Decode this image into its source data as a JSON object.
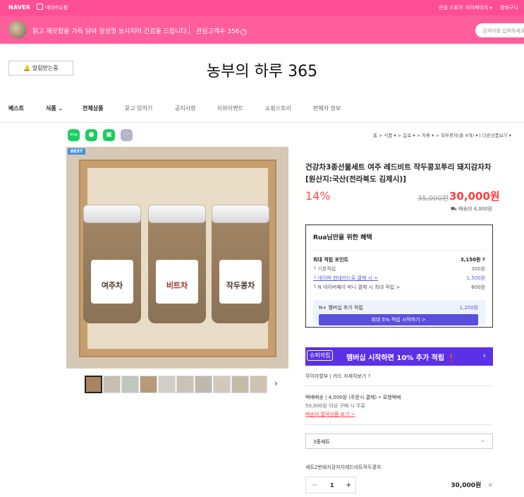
{
  "topbar": {
    "logo": "NAVER",
    "shop": "네이버쇼핑",
    "links": [
      "관심 스토어",
      "마이페이지 ▾",
      "장바구니"
    ]
  },
  "banner": {
    "desc": "맑고 깨끗함을 가득 담아 정성껏 농사지어 건강을 드립니다.",
    "fans_label": "관심고객수 356",
    "q": "?",
    "search_placeholder": "검색어를 입력하세요"
  },
  "notify": "🔔 알림받는중",
  "store_name": "농부의 하루 365",
  "nav": [
    "베스트",
    "식품 ⌄",
    "전체상품",
    "묻고 답하기",
    "공지사항",
    "리뷰이벤트",
    "쇼핑스토리",
    "판매자 정보"
  ],
  "share": [
    {
      "name": "blog",
      "color": "#19ce60",
      "glyph": "blog"
    },
    {
      "name": "talk",
      "color": "#19ce60",
      "glyph": "●"
    },
    {
      "name": "band",
      "color": "#19ce60",
      "glyph": "▣"
    },
    {
      "name": "more",
      "color": "#b0b6c8",
      "glyph": "···"
    }
  ],
  "breadcrumb": "홈 > 식품 ▾ > 음료 ▾ > 차류 ▾ > 작두콩차(총 4개) ▾ | 다른상품보기 ▾",
  "photo": {
    "badge": "BEST",
    "jars": [
      "여주차",
      "비트차",
      "작두콩차"
    ]
  },
  "thumb_next": "›",
  "product": {
    "title": "건강차3종선물세트 여주 레드비트 작두콩꼬투리 돼지감자차 [원산지:국산(전라북도 김제시)]",
    "discount": "14%",
    "original": "35,000원",
    "price": "30,000원",
    "shipping": "배송비 4,000원"
  },
  "benefit": {
    "title": "Rua님만을 위한 혜택",
    "rows": [
      {
        "label": "최대 적립 포인트",
        "value": "3,150원 ?"
      },
      {
        "label": "└ 기본적립",
        "value": "300원"
      },
      {
        "label": "└ 네이버 현대카드로 결제 시 >",
        "value": "1,500원"
      },
      {
        "label": "└ N 네이버페이 머니 결제 시 최대 적립 >",
        "value": "600원"
      }
    ],
    "member_label": "N+ 멤버십 추가 적립",
    "member_value": "1,200원",
    "member_btn": "최대 5% 적립 시작하기 >"
  },
  "ad": {
    "tag": "슈퍼적립",
    "text": "멤버십 시작하면 10% 추가 적립 ❗",
    "arrow": "›"
  },
  "installment": "무이자할부 | 카드 자세히보기 ?",
  "shipping_info": {
    "line1": "택배배송 | 4,000원 (주문시 결제) • 로젠택배",
    "line2": "50,000원 이상 구매 시 무료",
    "line3": "배송비 절약상품 보기 >"
  },
  "option": {
    "select": "3종세트",
    "select_arrow": "⌄",
    "name": "세트2번돼지감자차레드비트작두콩차",
    "qty": "1",
    "minus": "−",
    "plus": "+",
    "price": "30,000원",
    "remove": "✕"
  },
  "colors": {
    "brand": "#ff4e95",
    "accent": "#ff3d3d",
    "member": "#5a4fdc"
  }
}
